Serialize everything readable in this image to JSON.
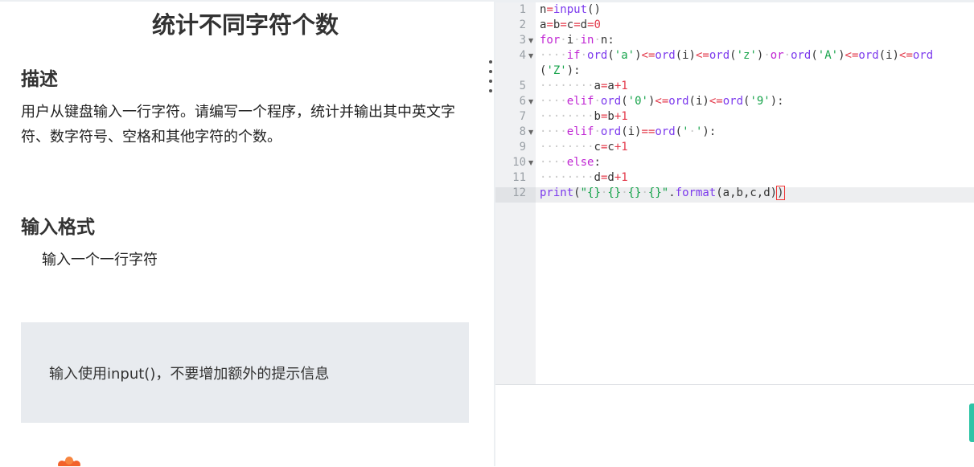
{
  "problem": {
    "title": "统计不同字符个数",
    "desc_heading": "描述",
    "desc_text": "用户从键盘输入一行字符。请编写一个程序，统计并输出其中英文字符、数字符号、空格和其他字符的个数。",
    "input_heading": "输入格式",
    "input_text": "输入一个一行字符",
    "note_text": "输入使用input()，不要增加额外的提示信息"
  },
  "editor": {
    "current_line": 12,
    "line_numbers": [
      "1",
      "2",
      "3",
      "4",
      "",
      "5",
      "6",
      "7",
      "8",
      "9",
      "10",
      "11",
      "12"
    ],
    "code_lines": [
      "n=input()",
      "a=b=c=d=0",
      "for i in n:",
      "    if ord('a')<=ord(i)<=ord('z') or ord('A')<=ord(i)<=ord",
      "('Z'):",
      "        a=a+1",
      "    elif ord('0')<=ord(i)<=ord('9'):",
      "        b=b+1",
      "    elif ord(i)==ord(' '):",
      "        c=c+1",
      "    else:",
      "        d=d+1",
      "print(\"{} {} {} {}\".format(a,b,c,d))"
    ]
  },
  "colors": {
    "keyword": "#c026d3",
    "operator": "#e33a4b",
    "string": "#16a34a",
    "function": "#7c3aed",
    "accent_tab": "#2ec4a6"
  }
}
